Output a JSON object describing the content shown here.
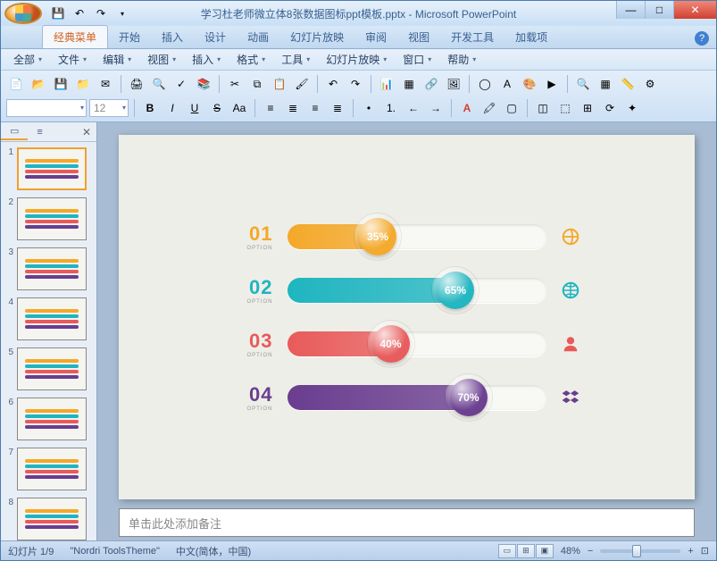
{
  "window": {
    "title": "学习杜老师微立体8张数据图标ppt模板.pptx - Microsoft PowerPoint"
  },
  "tabs": [
    "经典菜单",
    "开始",
    "插入",
    "设计",
    "动画",
    "幻灯片放映",
    "审阅",
    "视图",
    "开发工具",
    "加载项"
  ],
  "active_tab": 0,
  "menu": [
    "全部",
    "文件",
    "编辑",
    "视图",
    "插入",
    "格式",
    "工具",
    "幻灯片放映",
    "窗口",
    "帮助"
  ],
  "font_size_hint": "12",
  "chart_data": {
    "type": "bar",
    "title": "",
    "xlabel": "",
    "ylabel": "",
    "ylim": [
      0,
      100
    ],
    "series": [
      {
        "id": "01",
        "sub": "OPTION",
        "value": 35,
        "color": "#f4a829",
        "icon": "ie"
      },
      {
        "id": "02",
        "sub": "OPTION",
        "value": 65,
        "color": "#1fb5c0",
        "icon": "globe"
      },
      {
        "id": "03",
        "sub": "OPTION",
        "value": 40,
        "color": "#e85a5a",
        "icon": "user"
      },
      {
        "id": "04",
        "sub": "OPTION",
        "value": 70,
        "color": "#6a3d8f",
        "icon": "dropbox"
      }
    ]
  },
  "thumbnails": [
    1,
    2,
    3,
    4,
    5,
    6,
    7,
    8
  ],
  "active_thumb": 1,
  "panel_tabs": {
    "slides": "▭",
    "outline": "≡"
  },
  "notes_placeholder": "单击此处添加备注",
  "status": {
    "slide": "幻灯片 1/9",
    "theme": "\"Nordri ToolsTheme\"",
    "lang": "中文(简体，中国)",
    "zoom": "48%"
  },
  "icons": {
    "save": "💾",
    "undo": "↶",
    "redo": "↷",
    "dropdown": "▾",
    "new": "📄",
    "open": "📂",
    "folder": "📁",
    "mail": "✉",
    "print": "🖨",
    "preview": "🔍",
    "spell": "✓",
    "cut": "✂",
    "copy": "⧉",
    "paste": "📋",
    "fmt": "🖌",
    "chart": "📊",
    "table": "▦",
    "link": "🔗",
    "pic": "🖼",
    "bold": "B",
    "italic": "I",
    "underline": "U",
    "strike": "S",
    "fontcase": "Aa",
    "alignl": "≡",
    "alignc": "≣",
    "alignr": "≡",
    "bullets": "•",
    "numbers": "1.",
    "indent": "→",
    "outdent": "←",
    "min": "—",
    "max": "□",
    "close": "✕",
    "help": "?"
  }
}
